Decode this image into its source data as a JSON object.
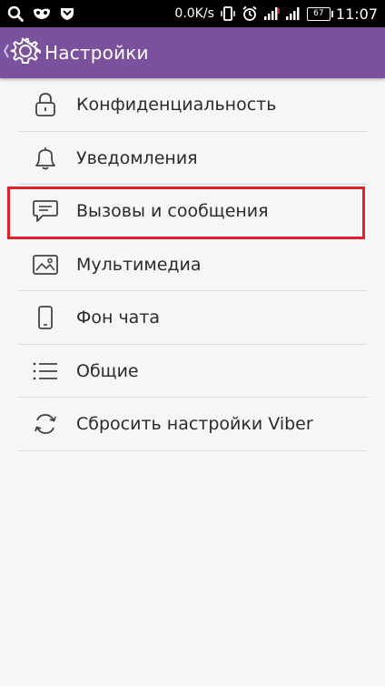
{
  "status_bar": {
    "speed": "0.0K/s",
    "battery": "67",
    "time": "11:07",
    "icons": [
      "search-icon",
      "mask-icon",
      "shield-icon",
      "vibrate-icon",
      "alarm-icon",
      "signal-icon",
      "signal-icon"
    ]
  },
  "app_bar": {
    "title": "Настройки",
    "background": "#7b519d"
  },
  "settings": {
    "items": [
      {
        "label": "Конфиденциальность",
        "icon": "lock-icon"
      },
      {
        "label": "Уведомления",
        "icon": "bell-icon"
      },
      {
        "label": "Вызовы и сообщения",
        "icon": "chat-bubble-icon"
      },
      {
        "label": "Мультимедиа",
        "icon": "image-icon"
      },
      {
        "label": "Фон чата",
        "icon": "phone-icon"
      },
      {
        "label": "Общие",
        "icon": "list-icon"
      },
      {
        "label": "Сбросить настройки Viber",
        "icon": "refresh-icon"
      }
    ],
    "highlighted_index": 2,
    "highlight_color": "#e2202a"
  }
}
